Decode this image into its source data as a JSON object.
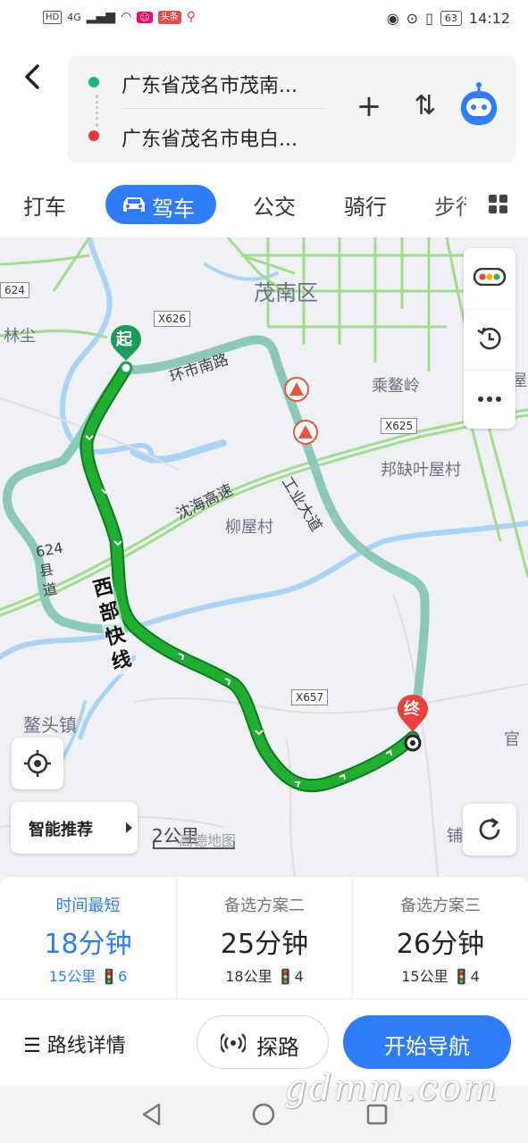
{
  "status_bar": {
    "left_chips": [
      "HD",
      "4G"
    ],
    "red_chip": "头条",
    "battery": "63",
    "time": "14:12"
  },
  "route": {
    "start_text": "广东省茂名市茂南...",
    "end_text": "广东省茂名市电白...",
    "start_dot_color": "#19b86b",
    "end_dot_color": "#e83a3a",
    "add_symbol": "+",
    "swap_symbol": "⇅"
  },
  "modes": {
    "taxi": "打车",
    "drive": "驾车",
    "bus": "公交",
    "ride": "骑行",
    "walk": "步行"
  },
  "map": {
    "labels": {
      "district": "茂南区",
      "linchen": "林尘",
      "chengaoling": "乘鳌岭",
      "bangque": "邦缺叶屋村",
      "liuwu": "柳屋村",
      "aotou": "鳌头镇",
      "guan": "官",
      "pu": "铺",
      "ju": "屋",
      "x624_left": "624"
    },
    "road_names": {
      "huanshi": "环市南路",
      "gongye": "工业大道",
      "shenhai": "沈海高速",
      "xibu": "西部快线",
      "route624": "624县道"
    },
    "x_badges": [
      "X626",
      "X625",
      "X657"
    ],
    "start_marker": "起",
    "end_marker": "终",
    "scale": "2公里",
    "logo": "高德地图",
    "smart_recommend": "智能推荐",
    "route_color": "#1fae2f",
    "road_color": "#8fd07f",
    "alt_route_color": "#8cc9b9"
  },
  "routes": [
    {
      "label": "时间最短",
      "time": "18分钟",
      "distance": "15公里",
      "lights": "6",
      "selected": true
    },
    {
      "label": "备选方案二",
      "time": "25分钟",
      "distance": "18公里",
      "lights": "4",
      "selected": false
    },
    {
      "label": "备选方案三",
      "time": "26分钟",
      "distance": "15公里",
      "lights": "4",
      "selected": false
    }
  ],
  "actions": {
    "detail": "路线详情",
    "probe": "探路",
    "start": "开始导航"
  },
  "watermark": "gdmm.com",
  "accent_color": "#2f7df6"
}
